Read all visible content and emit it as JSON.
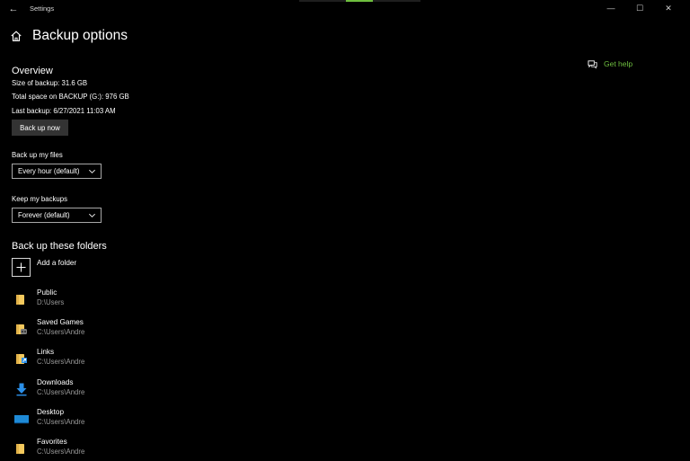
{
  "window": {
    "title": "Settings",
    "back_glyph": "←",
    "minimize_glyph": "—",
    "maximize_glyph": "☐",
    "close_glyph": "✕"
  },
  "colors": {
    "accent": "#6fbf3f",
    "folder_yellow": "#f4c95d",
    "download_blue": "#2b8fe8",
    "desktop_blue": "#1e8ad6"
  },
  "page": {
    "title": "Backup options",
    "home_icon": "home-icon"
  },
  "help": {
    "label": "Get help",
    "icon": "chat-help-icon"
  },
  "overview": {
    "heading": "Overview",
    "size_line": "Size of backup: 31.6 GB",
    "space_line": "Total space on BACKUP (G:): 976 GB",
    "last_line": "Last backup: 6/27/2021 11:03 AM",
    "backup_button": "Back up now"
  },
  "settings": {
    "files_label": "Back up my files",
    "files_value": "Every hour (default)",
    "keep_label": "Keep my backups",
    "keep_value": "Forever (default)"
  },
  "folders": {
    "heading": "Back up these folders",
    "add_label": "Add a folder",
    "items": [
      {
        "name": "Public",
        "path": "D:\\Users",
        "icon": "public-folder-icon"
      },
      {
        "name": "Saved Games",
        "path": "C:\\Users\\Andre",
        "icon": "saved-games-folder-icon"
      },
      {
        "name": "Links",
        "path": "C:\\Users\\Andre",
        "icon": "links-folder-icon"
      },
      {
        "name": "Downloads",
        "path": "C:\\Users\\Andre",
        "icon": "downloads-icon"
      },
      {
        "name": "Desktop",
        "path": "C:\\Users\\Andre",
        "icon": "desktop-icon"
      },
      {
        "name": "Favorites",
        "path": "C:\\Users\\Andre",
        "icon": "favorites-folder-icon"
      }
    ]
  }
}
